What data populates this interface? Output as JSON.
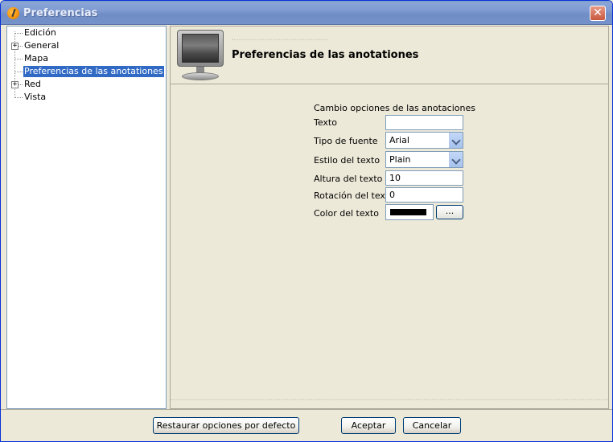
{
  "window": {
    "title": "Preferencias"
  },
  "tree": {
    "items": [
      {
        "label": "Edición",
        "expandable": false,
        "selected": false
      },
      {
        "label": "General",
        "expandable": true,
        "selected": false
      },
      {
        "label": "Mapa",
        "expandable": false,
        "selected": false
      },
      {
        "label": "Preferencias de las anotationes",
        "expandable": false,
        "selected": true
      },
      {
        "label": "Red",
        "expandable": true,
        "selected": false
      },
      {
        "label": "Vista",
        "expandable": false,
        "selected": false
      }
    ]
  },
  "panel": {
    "title": "Preferencias de las anotationes",
    "icon": "monitor-icon",
    "section_heading": "Cambio opciones de las anotaciones",
    "fields": {
      "texto": {
        "label": "Texto",
        "value": ""
      },
      "tipo_fuente": {
        "label": "Tipo de fuente",
        "value": "Arial"
      },
      "estilo_texto": {
        "label": "Estilo del texto",
        "value": "Plain"
      },
      "altura_texto": {
        "label": "Altura del texto",
        "value": "10"
      },
      "rotacion_texto": {
        "label": "Rotación del texto",
        "value": "0"
      },
      "color_texto": {
        "label": "Color del texto",
        "value": "#000000",
        "button_label": "..."
      }
    }
  },
  "footer": {
    "restore_label": "Restaurar opciones por defecto",
    "accept_label": "Aceptar",
    "cancel_label": "Cancelar"
  },
  "colors": {
    "selection": "#316ac5",
    "titlebar": "#7f9bd2"
  }
}
